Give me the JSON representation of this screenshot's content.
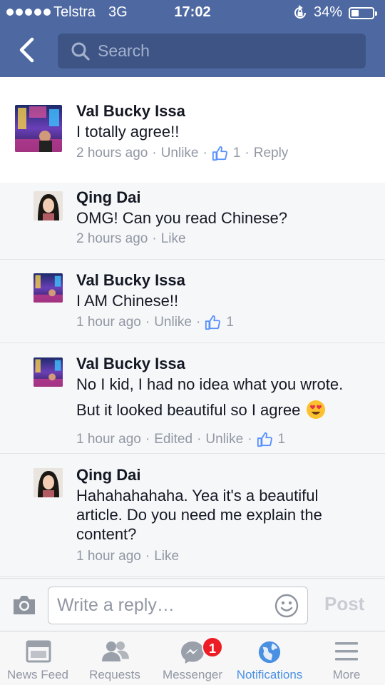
{
  "status_bar": {
    "carrier": "Telstra",
    "network": "3G",
    "time": "17:02",
    "battery": "34%",
    "battery_level": 0.34
  },
  "search": {
    "placeholder": "Search"
  },
  "comments": [
    {
      "author": "Val Bucky Issa",
      "text": "I totally agree!!",
      "time": "2 hours ago",
      "actions": [
        "Unlike"
      ],
      "likes": "1",
      "reply": "Reply"
    },
    {
      "author": "Qing Dai",
      "text": "OMG! Can you read Chinese?",
      "time": "2 hours ago",
      "actions": [
        "Like"
      ]
    },
    {
      "author": "Val Bucky Issa",
      "text": "I AM Chinese!!",
      "time": "1 hour ago",
      "actions": [
        "Unlike"
      ],
      "likes": "1"
    },
    {
      "author": "Val Bucky Issa",
      "text_line1": "No I kid, I had no idea what you wrote.",
      "text_line2": "But it looked beautiful so I agree",
      "time": "1 hour ago",
      "actions": [
        "Edited",
        "Unlike"
      ],
      "likes": "1"
    },
    {
      "author": "Qing Dai",
      "text": "Hahahahahaha. Yea it's a beautiful article. Do you need me explain the content?",
      "time": "1 hour ago",
      "actions": [
        "Like"
      ]
    }
  ],
  "reply_bar": {
    "placeholder": "Write a reply…",
    "post_label": "Post"
  },
  "tabs": [
    {
      "label": "News Feed",
      "icon": "news-feed-icon"
    },
    {
      "label": "Requests",
      "icon": "friend-requests-icon"
    },
    {
      "label": "Messenger",
      "icon": "messenger-icon",
      "badge": "1"
    },
    {
      "label": "Notifications",
      "icon": "globe-icon",
      "active": true
    },
    {
      "label": "More",
      "icon": "menu-icon"
    }
  ],
  "colors": {
    "header": "#4e69a2",
    "search_box": "#3d5485",
    "active_tab": "#4a90e2",
    "badge": "#ec1d25",
    "like_icon": "#5890ff"
  }
}
